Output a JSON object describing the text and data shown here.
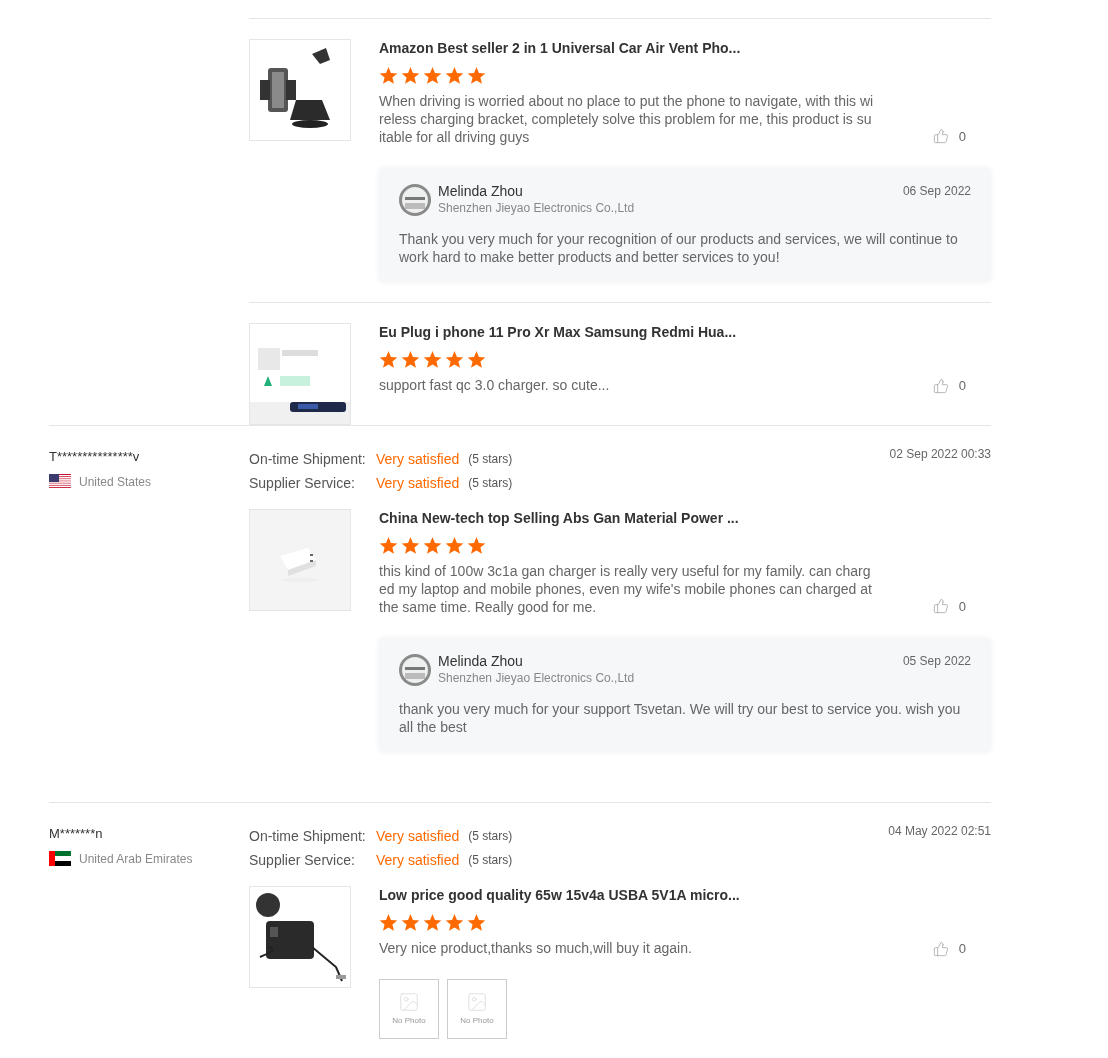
{
  "review_groups": [
    {
      "products": [
        {
          "title": "Amazon Best seller 2 in 1 Universal Car Air Vent Pho...",
          "stars": 5,
          "text": "When driving is worried about no place to put the phone to navigate, with this wireless charging bracket, completely solve this problem for me, this product is suitable for all driving guys",
          "likes": "0",
          "reply": {
            "name": "Melinda Zhou",
            "company": "Shenzhen Jieyao Electronics Co.,Ltd",
            "date": "06 Sep 2022",
            "text": "Thank you very much for your recognition of our products and services, we will continue to work hard to make better products and better services to you!"
          }
        },
        {
          "title": "Eu Plug i phone 11 Pro Xr Max Samsung Redmi Hua...",
          "stars": 5,
          "text": "support fast qc 3.0 charger. so cute...",
          "likes": "0"
        }
      ]
    },
    {
      "reviewer": {
        "name": "T***************v",
        "country": "United States",
        "kind": "us"
      },
      "date": "02 Sep 2022 00:33",
      "ratings": [
        {
          "label": "On-time Shipment:",
          "value": "Very satisfied",
          "note": "(5 stars)"
        },
        {
          "label": "Supplier Service:",
          "value": "Very satisfied",
          "note": "(5 stars)"
        }
      ],
      "products": [
        {
          "title": "China New-tech top Selling Abs Gan Material Power ...",
          "stars": 5,
          "text": "this kind of 100w 3c1a gan charger is really very useful for my family. can charged my laptop and mobile phones, even my wife's mobile phones can charged at the same time. Really good for me.",
          "likes": "0",
          "reply": {
            "name": "Melinda Zhou",
            "company": "Shenzhen Jieyao Electronics Co.,Ltd",
            "date": "05 Sep 2022",
            "text": "thank you very much for your support Tsvetan. We will try our best to service you. wish you all the best"
          }
        }
      ]
    },
    {
      "reviewer": {
        "name": "M*******n",
        "country": "United Arab Emirates",
        "kind": "ae"
      },
      "date": "04 May 2022 02:51",
      "ratings": [
        {
          "label": "On-time Shipment:",
          "value": "Very satisfied",
          "note": "(5 stars)"
        },
        {
          "label": "Supplier Service:",
          "value": "Very satisfied",
          "note": "(5 stars)"
        }
      ],
      "products": [
        {
          "title": "Low price good quality 65w 15v4a USBA 5V1A micro...",
          "stars": 5,
          "text": "Very nice product,thanks so much,will buy it again.",
          "likes": "0",
          "photos": [
            {
              "label": "No Photo"
            },
            {
              "label": "No Photo"
            }
          ]
        }
      ]
    }
  ]
}
